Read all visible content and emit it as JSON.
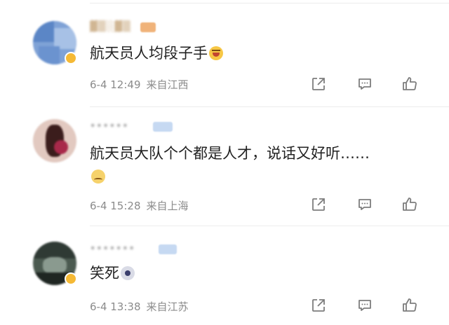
{
  "comments": [
    {
      "username": "▓▒░▓▒",
      "content": "航天员人均段子手",
      "emoji": "laughing-emoji",
      "time": "6-4 12:49",
      "location": "来自江西"
    },
    {
      "username": "••••••",
      "content": "航天员大队个个都是人才，说话又好听……",
      "emoji": "sweat-emoji",
      "time": "6-4 15:28",
      "location": "来自上海"
    },
    {
      "username": "•••••••",
      "content": "笑死",
      "emoji": "dog-emoji",
      "time": "6-4 13:38",
      "location": "来自江苏"
    }
  ],
  "icons": {
    "share": "share-icon",
    "comment": "comment-icon",
    "like": "thumbs-up-icon"
  },
  "colors": {
    "text": "#222222",
    "meta": "#8b8b8b",
    "icon": "#7d7d7d",
    "vip_badge": "#f5b935"
  }
}
